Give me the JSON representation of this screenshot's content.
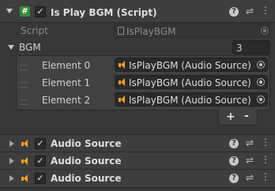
{
  "component": {
    "title": "Is Play BGM (Script)",
    "enabled": true,
    "script_label": "Script",
    "script_value": "IsPlayBGM",
    "icons": [
      "help-icon",
      "presets-icon",
      "context-menu-icon"
    ]
  },
  "bgm": {
    "label": "BGM",
    "size": "3",
    "elements": [
      {
        "label": "Element 0",
        "value": "IsPlayBGM (Audio Source)"
      },
      {
        "label": "Element 1",
        "value": "IsPlayBGM (Audio Source)"
      },
      {
        "label": "Element 2",
        "value": "IsPlayBGM (Audio Source)"
      }
    ],
    "add_label": "+",
    "remove_label": "-"
  },
  "audio_sources": [
    {
      "title": "Audio Source",
      "enabled": true
    },
    {
      "title": "Audio Source",
      "enabled": true
    },
    {
      "title": "Audio Source",
      "enabled": true
    }
  ],
  "colors": {
    "accent": "#f0a020",
    "background": "#383838",
    "field": "#2a2a2a"
  }
}
